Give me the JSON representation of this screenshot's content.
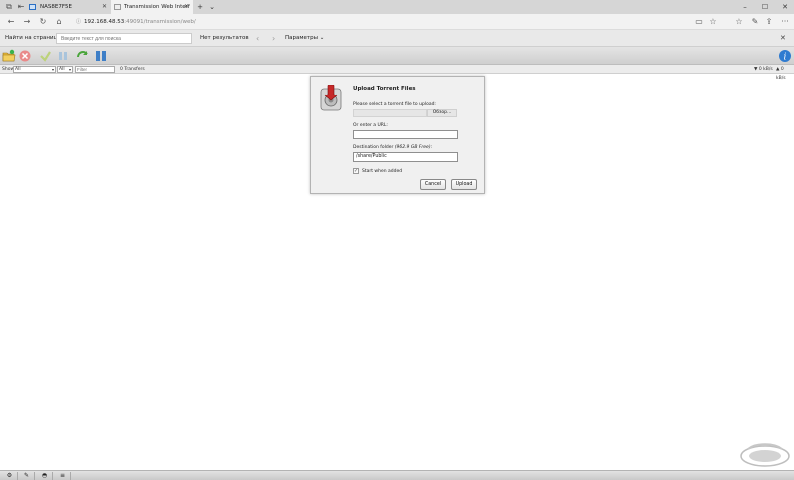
{
  "browser": {
    "tabs": [
      {
        "label": "NAS8E7F5E"
      },
      {
        "label": "Transmission Web Interf"
      }
    ],
    "new_tab_label": "+",
    "address": {
      "host": "192.168.48.53",
      "rest": ":49091/transmission/web/"
    }
  },
  "findbar": {
    "label": "Найти на странице",
    "placeholder": "Введите текст для поиска",
    "results": "Нет результатов",
    "params": "Параметры"
  },
  "filterbar": {
    "show_label": "Show",
    "show_value": "All",
    "tracker_value": "All",
    "filter_placeholder": "Filter",
    "transfers": "0 Transfers",
    "down_speed": "▼ 0 kB/s",
    "up_speed": "▲ 0 kB/s"
  },
  "dialog": {
    "title": "Upload Torrent Files",
    "file_label": "Please select a torrent file to upload:",
    "browse_label": "Обзор...",
    "url_label": "Or enter a URL:",
    "dest_label": "Destination folder",
    "dest_free": "(962.9 GB Free)",
    "dest_colon": ":",
    "dest_value": "/share/Public",
    "start_label": "Start when added",
    "start_checked": true,
    "cancel_label": "Cancel",
    "upload_label": "Upload"
  },
  "colors": {
    "accent": "#2b6fc4",
    "dialog_bg": "#f0f0f0"
  }
}
